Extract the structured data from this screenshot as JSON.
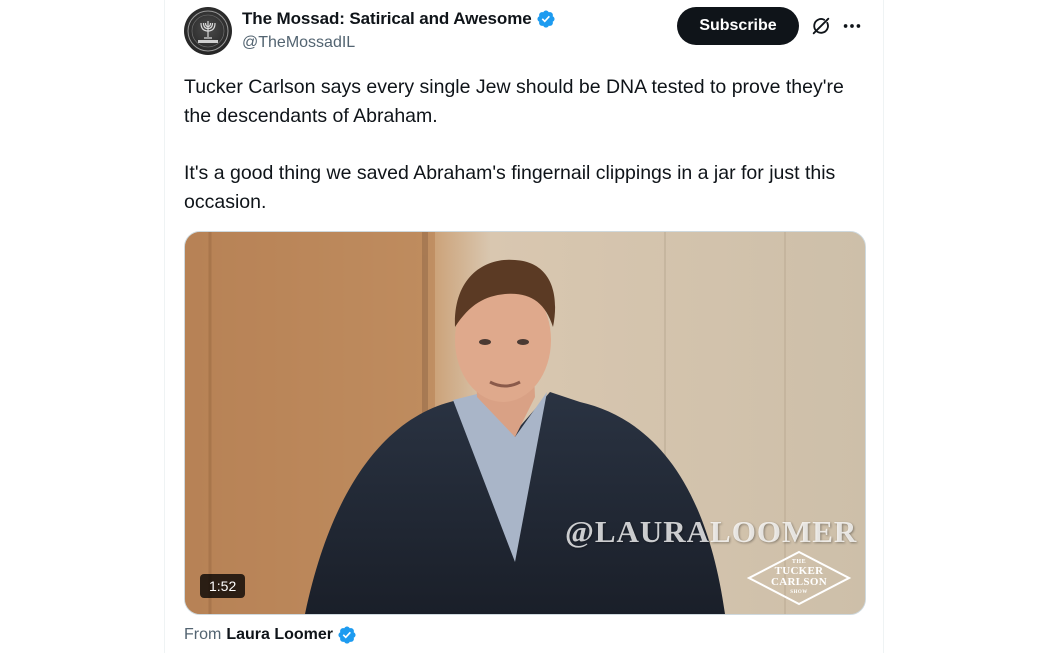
{
  "author": {
    "display_name": "The Mossad: Satirical and Awesome",
    "handle": "@TheMossadIL",
    "verified_icon": "verified-badge-icon",
    "avatar_icon": "menorah-emblem-icon"
  },
  "actions": {
    "subscribe_label": "Subscribe",
    "grok_icon": "grok-icon",
    "more_icon": "more-options-icon"
  },
  "tweet": {
    "paragraph_1": "Tucker Carlson says every single Jew should be DNA tested to prove they're the descendants of Abraham.",
    "paragraph_2": "It's a good thing we saved Abraham's fingernail clippings in a jar for just this occasion."
  },
  "media": {
    "watermark": "@LAURALOOMER",
    "show_logo_the": "THE",
    "show_logo_main": "TUCKER\nCARLSON",
    "show_logo_show": "SHOW",
    "duration": "1:52"
  },
  "attribution": {
    "from_label": "From",
    "source_name": "Laura Loomer"
  },
  "colors": {
    "verified_blue": "#1d9bf0",
    "text_primary": "#0f1419",
    "text_secondary": "#536471",
    "button_bg": "#0f1419"
  }
}
